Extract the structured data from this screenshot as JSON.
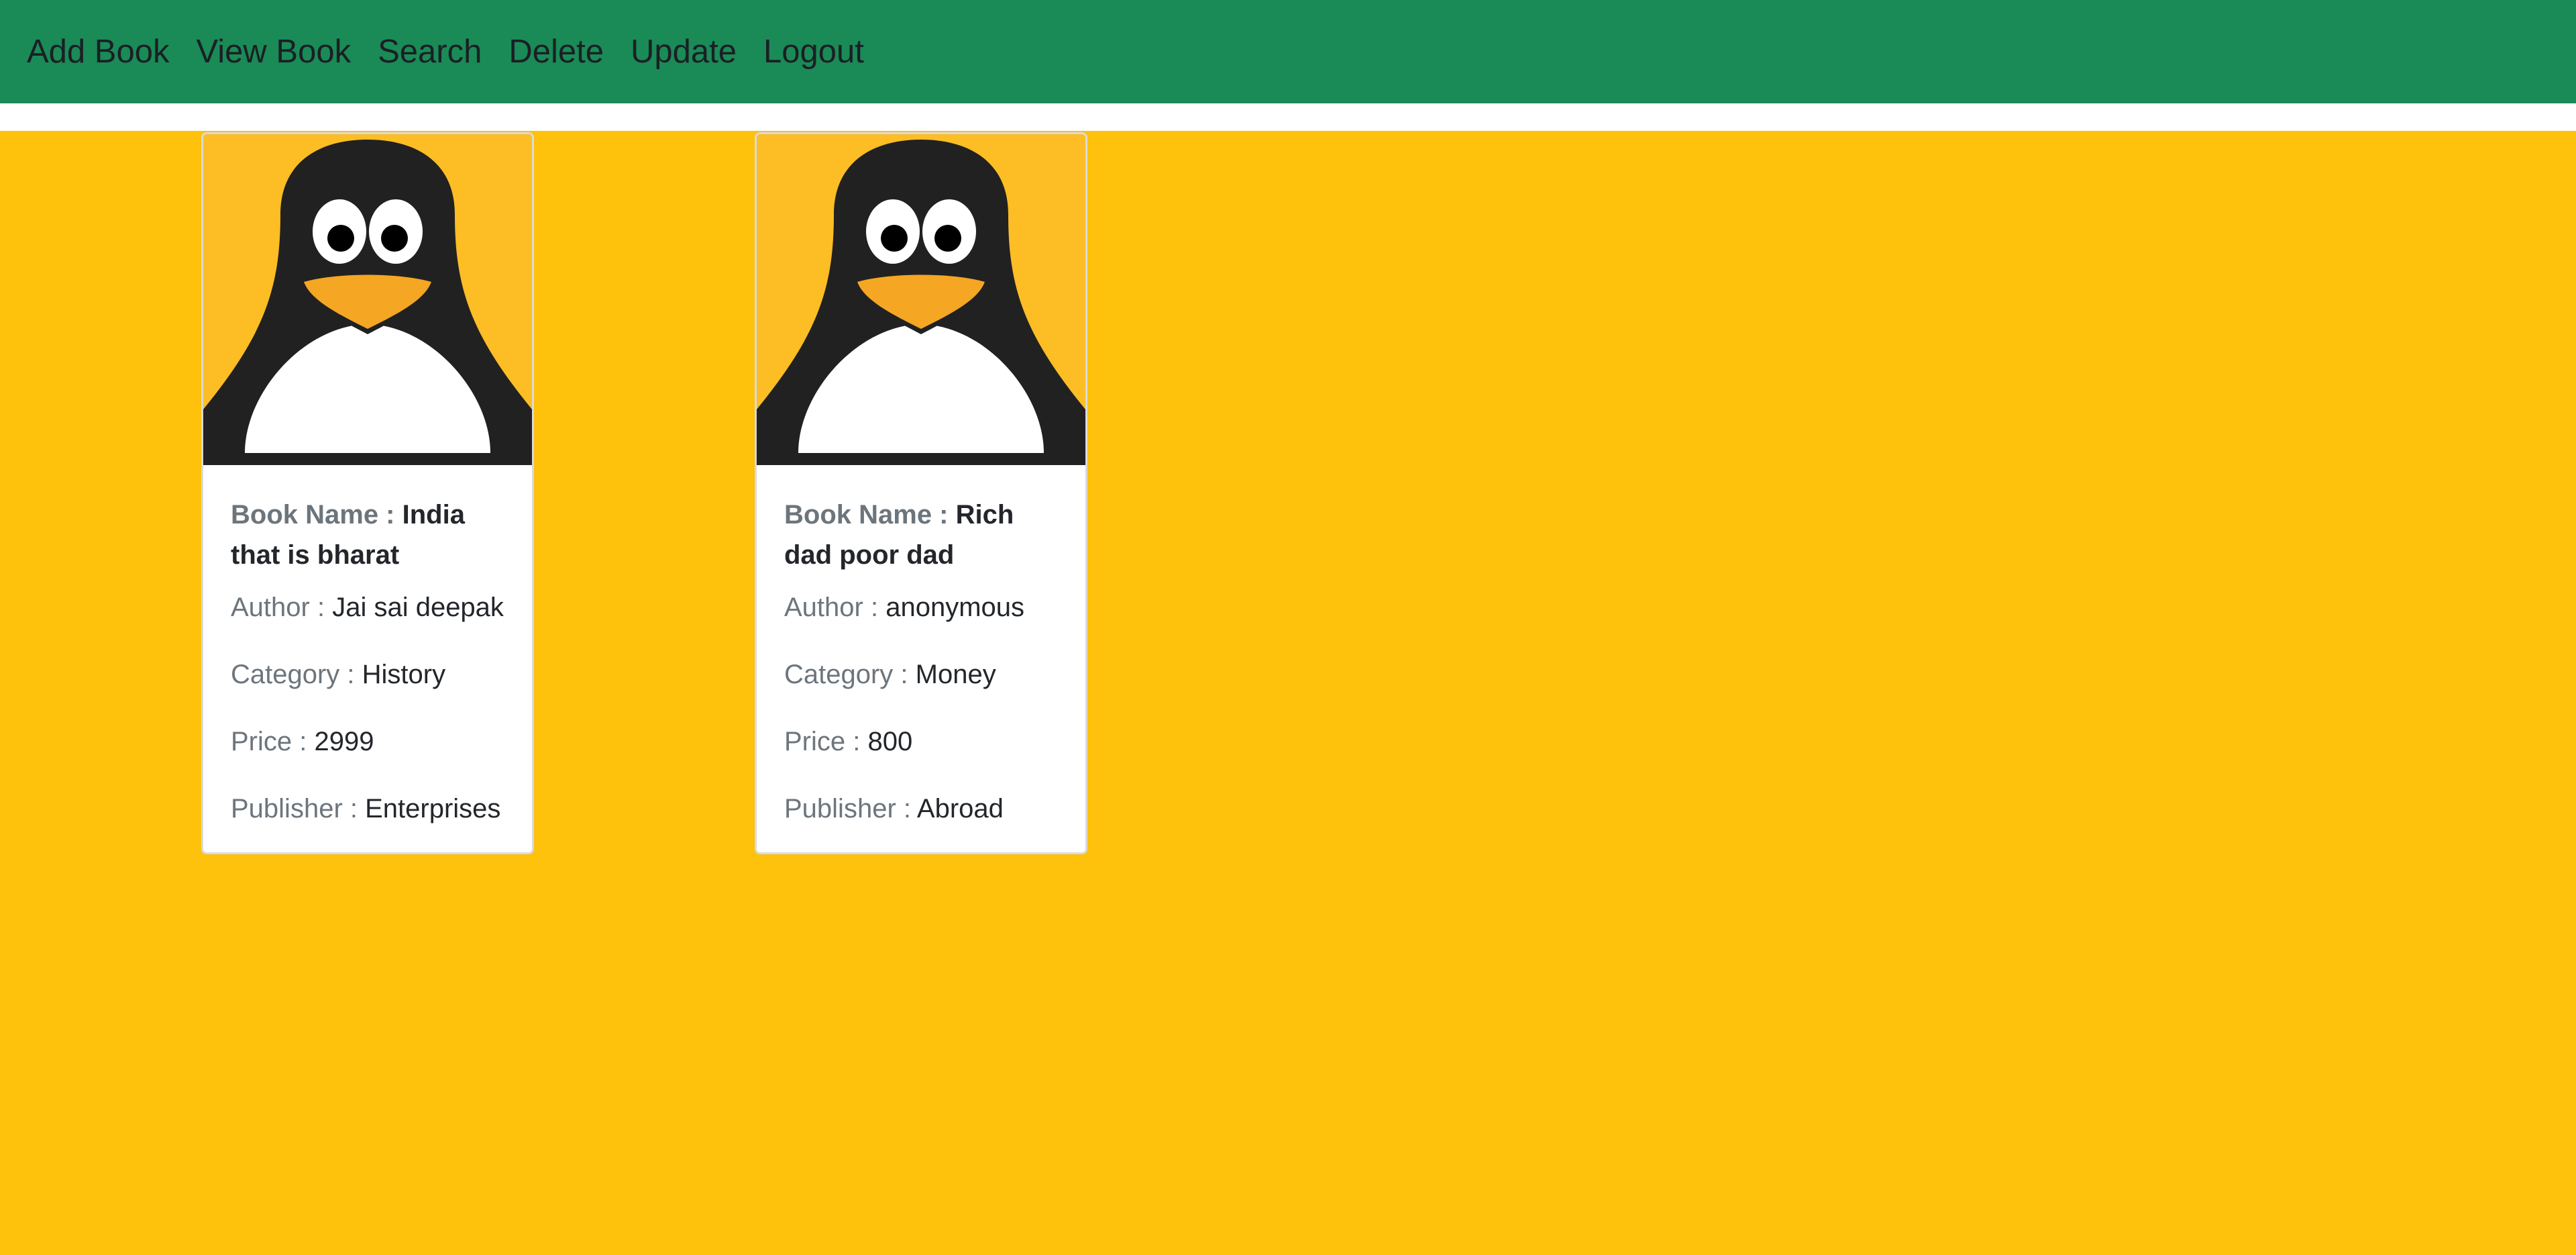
{
  "nav": {
    "items": [
      "Add Book",
      "View Book",
      "Search",
      "Delete",
      "Update",
      "Logout"
    ]
  },
  "colors": {
    "navbar": "#1a8a57",
    "page_background": "#fec10c",
    "card_background": "#ffffff",
    "label_text": "#6d757c",
    "value_text": "#23262a"
  },
  "labels": {
    "book_name": "Book Name : ",
    "author": "Author : ",
    "category": "Category : ",
    "price": "Price : ",
    "publisher": "Publisher : "
  },
  "books": [
    {
      "image_icon": "tux-penguin-icon",
      "name": "India that is bharat",
      "author": "Jai sai deepak",
      "category": "History",
      "price": "2999",
      "publisher": "Enterprises"
    },
    {
      "image_icon": "tux-penguin-icon",
      "name": "Rich dad poor dad",
      "author": "anonymous",
      "category": "Money",
      "price": "800",
      "publisher": "Abroad"
    }
  ]
}
